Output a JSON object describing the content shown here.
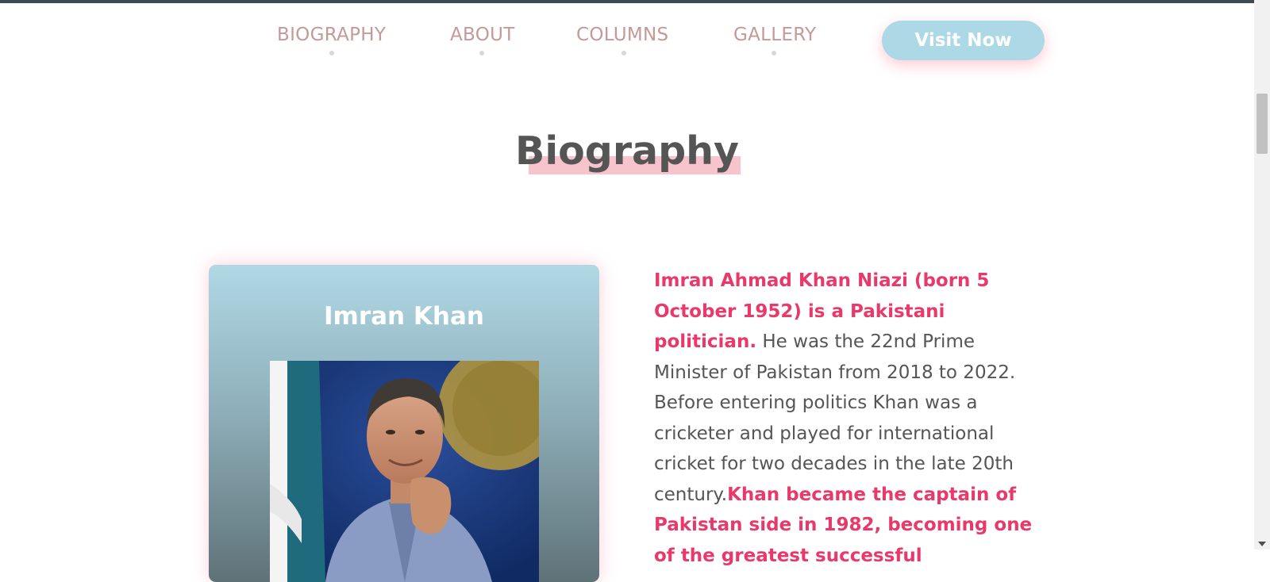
{
  "nav": {
    "items": [
      {
        "label": "BIOGRAPHY"
      },
      {
        "label": "ABOUT"
      },
      {
        "label": "COLUMNS"
      },
      {
        "label": "GALLERY"
      }
    ],
    "cta_label": "Visit Now"
  },
  "section": {
    "title": "Biography"
  },
  "card": {
    "name": "Imran Khan"
  },
  "bio": {
    "highlight_1": "Imran Ahmad Khan Niazi (born 5 October 1952) is a Pakistani politician.",
    "text_1": " He was the 22nd Prime Minister of Pakistan from 2018 to 2022. Before entering politics Khan was a cricketer and played for international cricket for two decades in the late 20th century.",
    "highlight_2": "Khan became the captain of Pakistan side in 1982, becoming one of the greatest successful"
  },
  "colors": {
    "accent_pink": "#e83a6a",
    "button_blue": "#add8e6",
    "nav_text": "#c39a98"
  }
}
